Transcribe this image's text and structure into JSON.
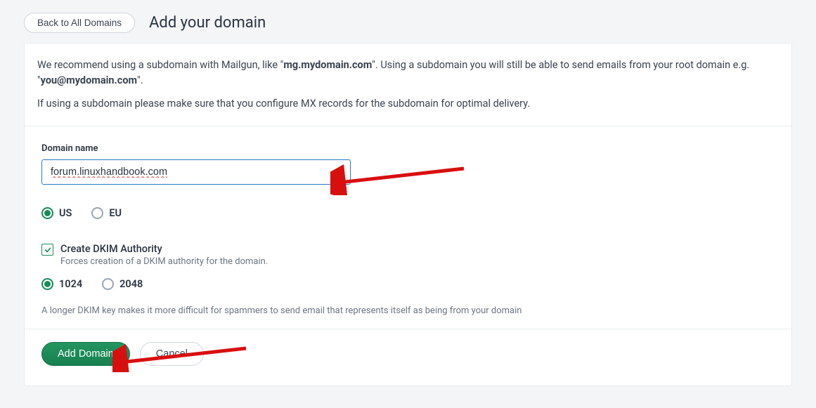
{
  "header": {
    "back_label": "Back to All Domains",
    "title": "Add your domain"
  },
  "intro": {
    "line1_pre": "We recommend using a subdomain with Mailgun, like \"",
    "line1_bold1": "mg.mydomain.com",
    "line1_mid": "\". Using a subdomain you will still be able to send emails from your root domain e.g. \"",
    "line1_bold2": "you@mydomain.com",
    "line1_post": "\".",
    "line2": "If using a subdomain please make sure that you configure MX records for the subdomain for optimal delivery."
  },
  "form": {
    "domain_label": "Domain name",
    "domain_value": "forum.linuxhandbook.com",
    "region": {
      "us": "US",
      "eu": "EU",
      "selected": "us"
    },
    "dkim": {
      "checkbox_label": "Create DKIM Authority",
      "checkbox_sub": "Forces creation of a DKIM authority for the domain.",
      "checked": true,
      "opt_1024": "1024",
      "opt_2048": "2048",
      "selected": "1024",
      "hint": "A longer DKIM key makes it more difficult for spammers to send email that represents itself as being from your domain"
    }
  },
  "actions": {
    "primary": "Add Domain",
    "cancel": "Cancel"
  }
}
